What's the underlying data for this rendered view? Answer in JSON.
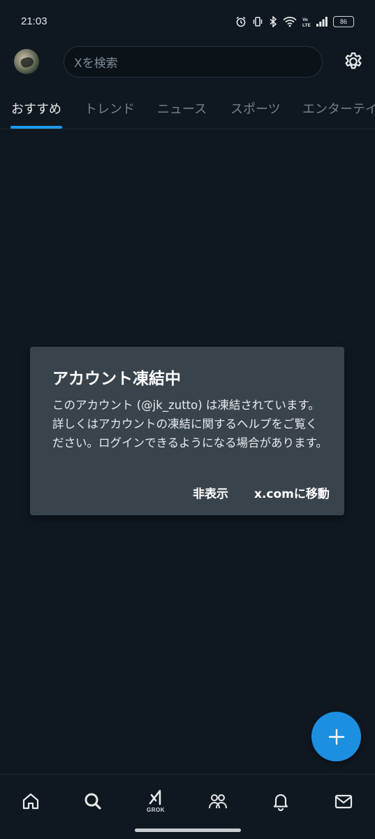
{
  "status_bar": {
    "time": "21:03",
    "battery": "86"
  },
  "header": {
    "search_placeholder": "Xを検索"
  },
  "tabs": [
    {
      "label": "おすすめ",
      "active": true
    },
    {
      "label": "トレンド"
    },
    {
      "label": "ニュース"
    },
    {
      "label": "スポーツ"
    },
    {
      "label": "エンターテイ"
    }
  ],
  "dialog": {
    "title": "アカウント凍結中",
    "body": "このアカウント (@jk_zutto) は凍結されています。詳しくはアカウントの凍結に関するヘルプをご覧ください。ログインできるようになる場合があります。",
    "hide_label": "非表示",
    "goto_label": "x.comに移動"
  },
  "bottom_nav": {
    "grok_label": "GROK"
  },
  "colors": {
    "background": "#0f1820",
    "accent": "#1d9bf0",
    "dialog": "#39434c"
  }
}
